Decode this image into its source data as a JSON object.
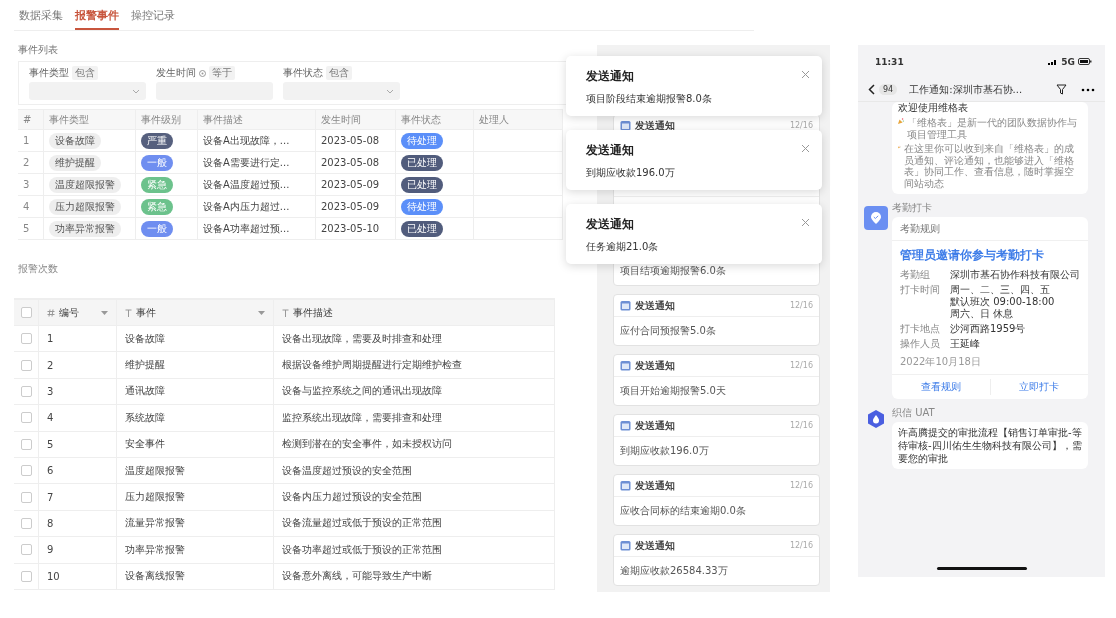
{
  "alarm_page": {
    "tabs": [
      {
        "label": "数据采集",
        "selected": false
      },
      {
        "label": "报警事件",
        "selected": true
      },
      {
        "label": "操控记录",
        "selected": false
      }
    ],
    "section_title": "事件列表",
    "filters": [
      {
        "label": "事件类型",
        "operator": "包含",
        "kind": "select"
      },
      {
        "label": "发生时间",
        "operator": "等于",
        "kind": "date"
      },
      {
        "label": "事件状态",
        "operator": "包含",
        "kind": "select"
      }
    ],
    "table": {
      "columns": [
        "#",
        "事件类型",
        "事件级别",
        "事件描述",
        "发生时间",
        "事件状态",
        "处理人"
      ],
      "rows": [
        {
          "index": "1",
          "type": "设备故障",
          "level": {
            "text": "严重",
            "color": "#56607e"
          },
          "description": "设备A出现故障，...",
          "time": "2023-05-08",
          "status": {
            "text": "待处理",
            "color": "#5b8ff9"
          }
        },
        {
          "index": "2",
          "type": "维护提醒",
          "level": {
            "text": "一般",
            "color": "#6f8ef0"
          },
          "description": "设备A需要进行定...",
          "time": "2023-05-08",
          "status": {
            "text": "已处理",
            "color": "#515c7c"
          }
        },
        {
          "index": "3",
          "type": "温度超限报警",
          "level": {
            "text": "紧急",
            "color": "#6cc28c"
          },
          "description": "设备A温度超过预...",
          "time": "2023-05-09",
          "status": {
            "text": "已处理",
            "color": "#515c7c"
          }
        },
        {
          "index": "4",
          "type": "压力超限报警",
          "level": {
            "text": "紧急",
            "color": "#6cc28c"
          },
          "description": "设备A内压力超过...",
          "time": "2023-05-09",
          "status": {
            "text": "待处理",
            "color": "#5b8ff9"
          }
        },
        {
          "index": "5",
          "type": "功率异常报警",
          "level": {
            "text": "一般",
            "color": "#6f8ef0"
          },
          "description": "设备A功率超过预...",
          "time": "2023-05-10",
          "status": {
            "text": "已处理",
            "color": "#515c7c"
          }
        }
      ]
    }
  },
  "grid_sheet": {
    "caption": "报警次数",
    "columns": [
      {
        "label": "编号",
        "kind": "number",
        "dropdown": true
      },
      {
        "label": "事件",
        "kind": "text",
        "dropdown": true
      },
      {
        "label": "事件描述",
        "kind": "text",
        "dropdown": false
      }
    ],
    "header_checked": false,
    "rows": [
      {
        "checked": false,
        "cells": [
          "1",
          "设备故障",
          "设备出现故障，需要及时排查和处理"
        ]
      },
      {
        "checked": false,
        "cells": [
          "2",
          "维护提醒",
          "根据设备维护周期提醒进行定期维护检查"
        ]
      },
      {
        "checked": false,
        "cells": [
          "3",
          "通讯故障",
          "设备与监控系统之间的通讯出现故障"
        ]
      },
      {
        "checked": false,
        "cells": [
          "4",
          "系统故障",
          "监控系统出现故障，需要排查和处理"
        ]
      },
      {
        "checked": false,
        "cells": [
          "5",
          "安全事件",
          "检测到潜在的安全事件，如未授权访问"
        ]
      },
      {
        "checked": false,
        "cells": [
          "6",
          "温度超限报警",
          "设备温度超过预设的安全范围"
        ]
      },
      {
        "checked": false,
        "cells": [
          "7",
          "压力超限报警",
          "设备内压力超过预设的安全范围"
        ]
      },
      {
        "checked": false,
        "cells": [
          "8",
          "流量异常报警",
          "设备流量超过或低于预设的正常范围"
        ]
      },
      {
        "checked": false,
        "cells": [
          "9",
          "功率异常报警",
          "设备功率超过或低于预设的正常范围"
        ]
      },
      {
        "checked": false,
        "cells": [
          "10",
          "设备离线报警",
          "设备意外离线，可能导致生产中断"
        ]
      }
    ]
  },
  "notifications": {
    "toasts": [
      {
        "title": "发送通知",
        "message": "项目阶段结束逾期报警8.0条"
      },
      {
        "title": "发送通知",
        "message": "到期应收款196.0万"
      },
      {
        "title": "发送通知",
        "message": "任务逾期21.0条"
      }
    ],
    "cards": [
      {
        "kind": "header",
        "title": "发送通知",
        "date": "12/16"
      },
      {
        "kind": "covered"
      },
      {
        "kind": "body",
        "body": "项目结项逾期报警6.0条"
      },
      {
        "kind": "full",
        "title": "发送通知",
        "date": "12/16",
        "body": "应付合同预报警5.0条"
      },
      {
        "kind": "full",
        "title": "发送通知",
        "date": "12/16",
        "body": "项目开始逾期报警5.0天"
      },
      {
        "kind": "full",
        "title": "发送通知",
        "date": "12/16",
        "body": "到期应收款196.0万"
      },
      {
        "kind": "full",
        "title": "发送通知",
        "date": "12/16",
        "body": "应收合同标的结束逾期0.0条"
      },
      {
        "kind": "full",
        "title": "发送通知",
        "date": "12/16",
        "body": "逾期应收款26584.33万"
      }
    ]
  },
  "phone": {
    "status_bar": {
      "time": "11:31",
      "network": "5G"
    },
    "nav": {
      "back_count": "94",
      "title": "工作通知:深圳市基石协..."
    },
    "welcome": {
      "heading": "欢迎使用维格表",
      "paragraphs": [
        "「维格表」是新一代的团队数据协作与项目管理工具",
        "在这里你可以收到来自「维格表」的成员通知、评论通知，也能够进入「维格表」协同工作、查看信息，随时掌握空间站动态"
      ]
    },
    "attendance": {
      "sender": "考勤打卡",
      "card_label": "考勤规则",
      "headline": "管理员邀请你参与考勤打卡",
      "fields": [
        {
          "label": "考勤组",
          "value": [
            "深圳市基石协作科技有限公司"
          ]
        },
        {
          "label": "打卡时间",
          "value": [
            "周一、二、三、四、五",
            "默认班次 09:00-18:00",
            "周六、日 休息"
          ]
        },
        {
          "label": "打卡地点",
          "value": [
            "沙河西路1959号"
          ]
        },
        {
          "label": "操作人员",
          "value": [
            "王延峰"
          ]
        }
      ],
      "date": "2022年10月18日",
      "actions": [
        "查看规则",
        "立即打卡"
      ]
    },
    "approval": {
      "sender": "织信 UAT",
      "message": "许高腾提交的审批流程【销售订单审批-等待审核-四川佑生生物科技有限公司】，需要您的审批"
    }
  }
}
